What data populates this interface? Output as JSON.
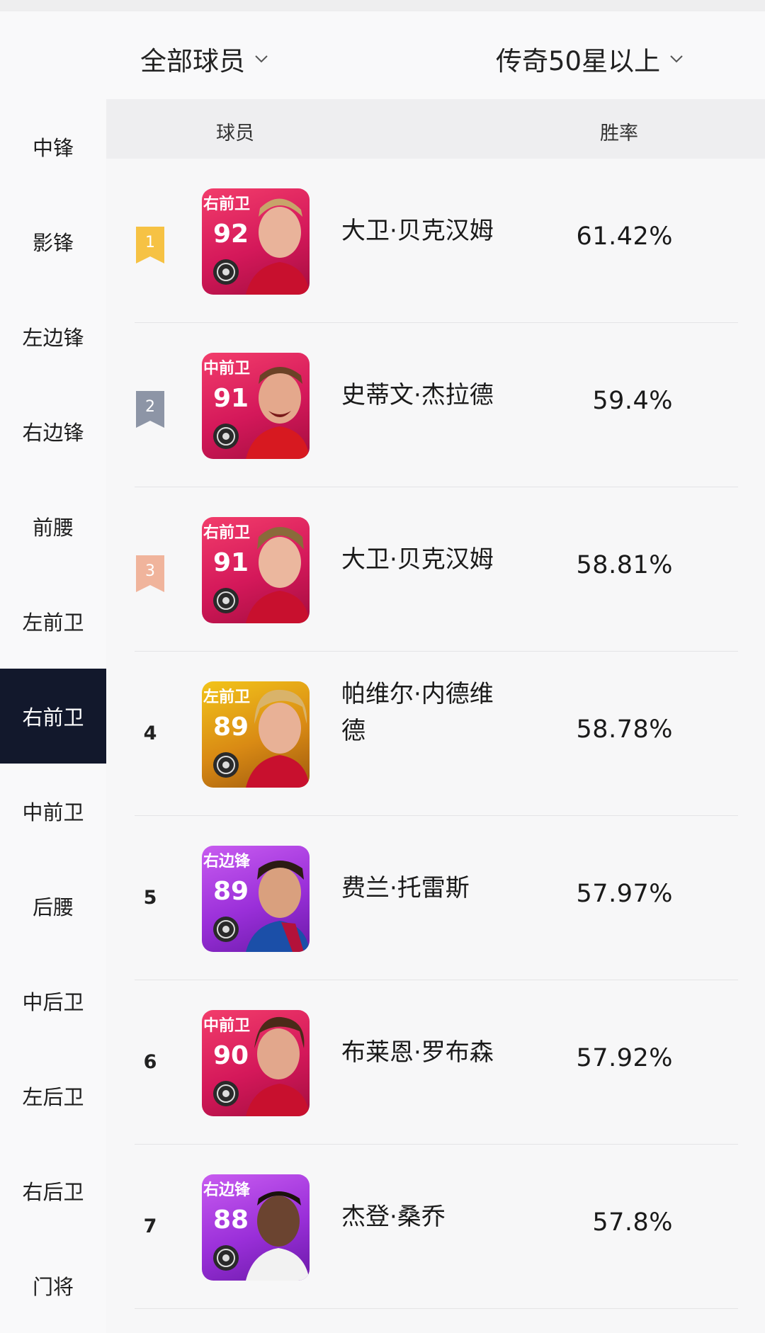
{
  "filters": {
    "scope": "全部球员",
    "tier": "传奇50星以上"
  },
  "sidebar": {
    "items": [
      {
        "label": "中锋"
      },
      {
        "label": "影锋"
      },
      {
        "label": "左边锋"
      },
      {
        "label": "右边锋"
      },
      {
        "label": "前腰"
      },
      {
        "label": "左前卫"
      },
      {
        "label": "右前卫",
        "active": true
      },
      {
        "label": "中前卫"
      },
      {
        "label": "后腰"
      },
      {
        "label": "中后卫"
      },
      {
        "label": "左后卫"
      },
      {
        "label": "右后卫"
      },
      {
        "label": "门将"
      }
    ]
  },
  "table": {
    "headers": {
      "player": "球员",
      "win_rate": "胜率"
    },
    "rows": [
      {
        "rank": "1",
        "position": "右前卫",
        "rating": "92",
        "name": "大卫·贝克汉姆",
        "win_rate": "61.42%",
        "card_color": "pink",
        "rank_badge": "gold"
      },
      {
        "rank": "2",
        "position": "中前卫",
        "rating": "91",
        "name": "史蒂文·杰拉德",
        "win_rate": "59.4%",
        "card_color": "pink",
        "rank_badge": "silver"
      },
      {
        "rank": "3",
        "position": "右前卫",
        "rating": "91",
        "name": "大卫·贝克汉姆",
        "win_rate": "58.81%",
        "card_color": "pink",
        "rank_badge": "bronze"
      },
      {
        "rank": "4",
        "position": "左前卫",
        "rating": "89",
        "name_line1": "帕维尔·内德维",
        "name_line2": "德",
        "win_rate": "58.78%",
        "card_color": "gold"
      },
      {
        "rank": "5",
        "position": "右边锋",
        "rating": "89",
        "name": "费兰·托雷斯",
        "win_rate": "57.97%",
        "card_color": "purple"
      },
      {
        "rank": "6",
        "position": "中前卫",
        "rating": "90",
        "name": "布莱恩·罗布森",
        "win_rate": "57.92%",
        "card_color": "pink"
      },
      {
        "rank": "7",
        "position": "右边锋",
        "rating": "88",
        "name": "杰登·桑乔",
        "win_rate": "57.8%",
        "card_color": "purple"
      }
    ]
  },
  "colors": {
    "active_sidebar": "#12182c",
    "rank_gold": "#f6c244",
    "rank_silver": "#8d95a6",
    "rank_bronze": "#f0b49c",
    "card_pink": "#d4185a",
    "card_gold": "#d98a14",
    "card_purple": "#9a2fd9"
  }
}
